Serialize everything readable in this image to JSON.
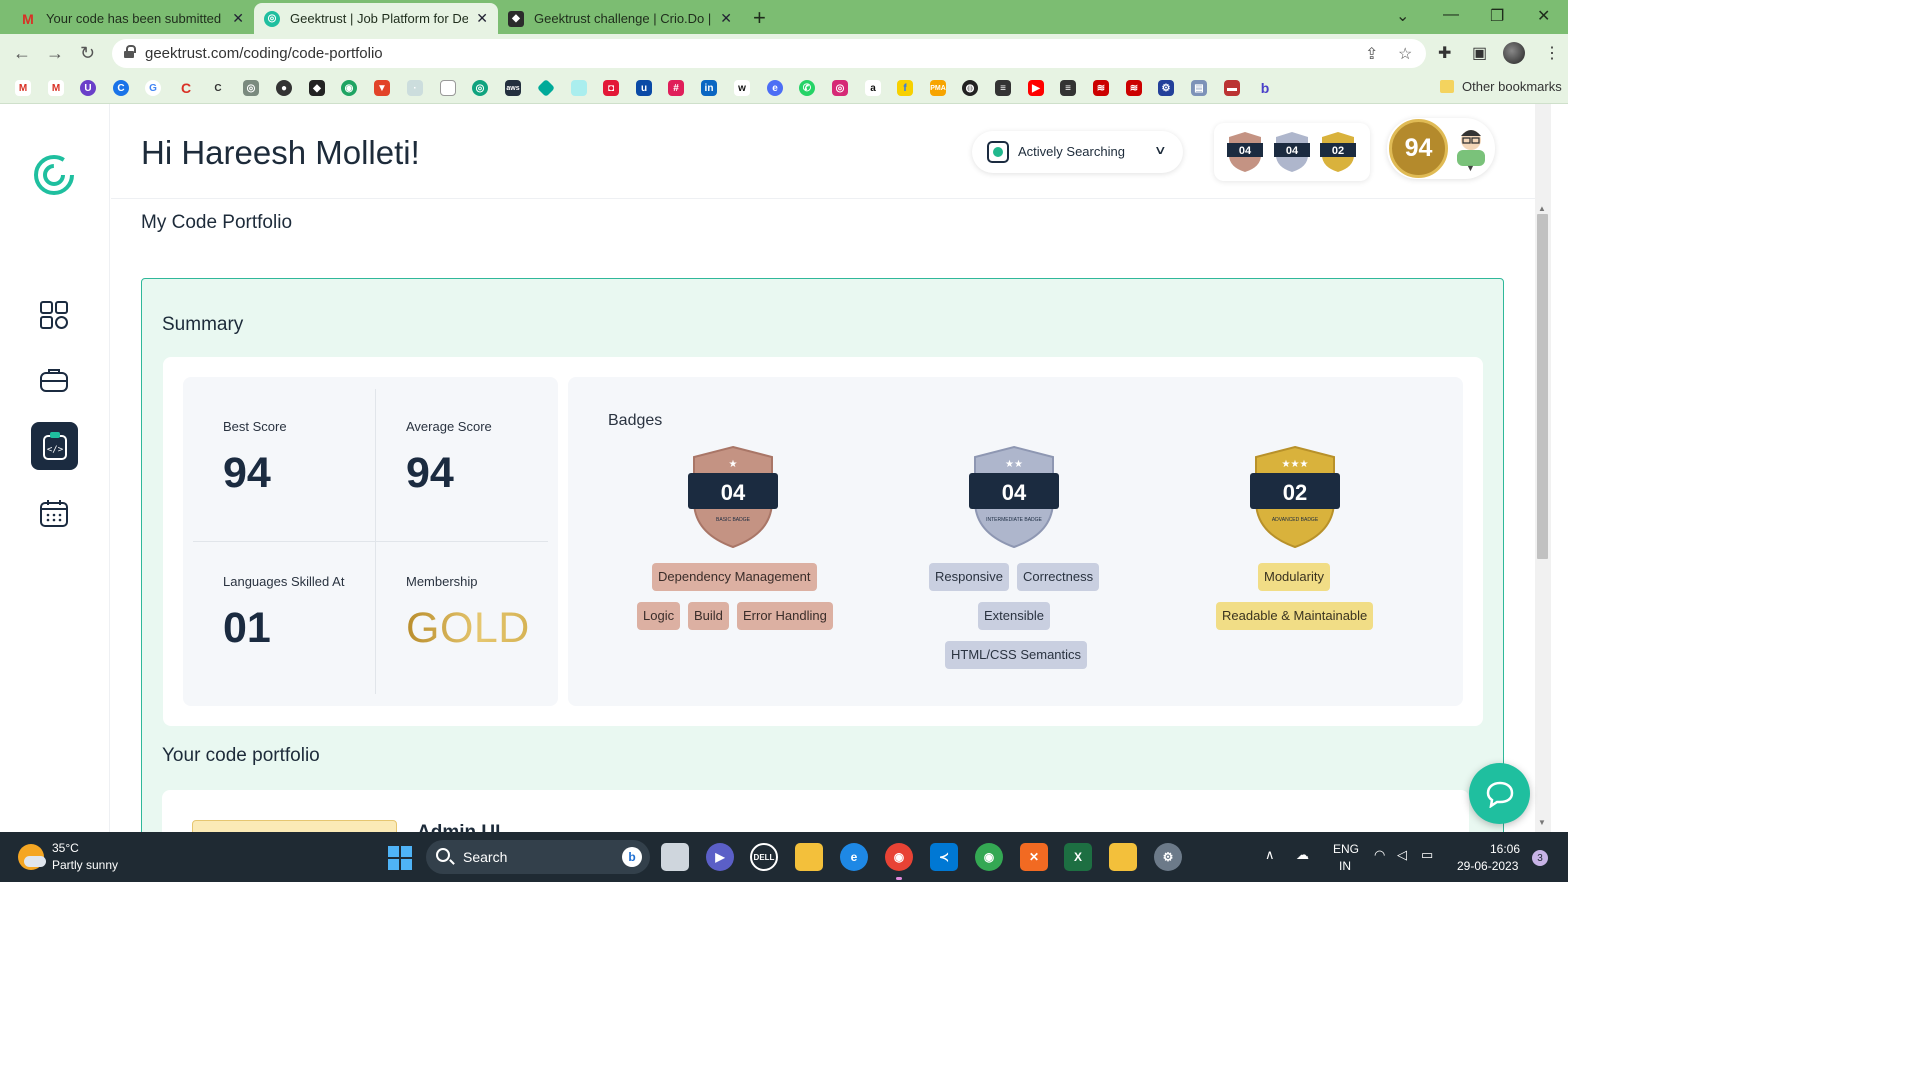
{
  "browser": {
    "tabs": [
      {
        "title": "Your code has been submitted su",
        "favicon": "gmail-icon",
        "active": false
      },
      {
        "title": "Geektrust | Job Platform for Deve",
        "favicon": "geektrust-icon",
        "active": true
      },
      {
        "title": "Geektrust challenge | Crio.Do | Bu",
        "favicon": "crio-icon",
        "active": false
      }
    ],
    "url": "geektrust.com/coding/code-portfolio",
    "bookmarks_other": "Other bookmarks"
  },
  "header": {
    "greeting": "Hi Hareesh Molleti!",
    "job_status": "Actively Searching",
    "mini_badges": [
      "04",
      "04",
      "02"
    ],
    "best_score_seal": "94"
  },
  "page": {
    "title": "My Code Portfolio"
  },
  "summary": {
    "title": "Summary",
    "stats": {
      "best_score_label": "Best Score",
      "best_score": "94",
      "average_score_label": "Average Score",
      "average_score": "94",
      "languages_label": "Languages Skilled At",
      "languages": "01",
      "membership_label": "Membership",
      "membership": "GOLD"
    },
    "badges_title": "Badges",
    "badges": [
      {
        "count": "04",
        "level": "BASIC BADGE",
        "color": "#c49383",
        "chips": [
          "Dependency Management",
          "Logic",
          "Build",
          "Error Handling"
        ]
      },
      {
        "count": "04",
        "level": "INTERMEDIATE BADGE",
        "color": "#aeb6cc",
        "chips": [
          "Responsive",
          "Correctness",
          "Extensible",
          "HTML/CSS Semantics"
        ]
      },
      {
        "count": "02",
        "level": "ADVANCED BADGE",
        "color": "#d9b23c",
        "chips": [
          "Modularity",
          "Readable & Maintainable"
        ]
      }
    ]
  },
  "portfolio": {
    "title": "Your code portfolio",
    "first_project": "Admin UI"
  },
  "taskbar": {
    "weather_temp": "35°C",
    "weather_desc": "Partly sunny",
    "search": "Search",
    "lang_line1": "ENG",
    "lang_line2": "IN",
    "time": "16:06",
    "date": "29-06-2023",
    "notifications": "3"
  },
  "colors": {
    "accent": "#1fbf9f",
    "navy": "#1b2b40",
    "chrome_green": "#7cbd72"
  }
}
